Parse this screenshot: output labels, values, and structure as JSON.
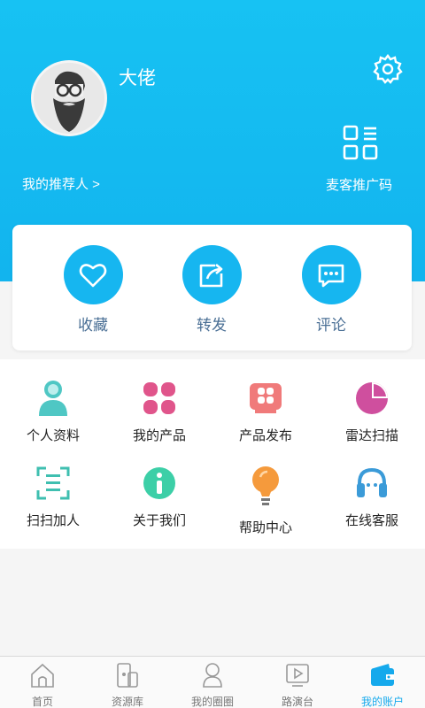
{
  "profile": {
    "username": "大佬",
    "recommender_label": "我的推荐人 >",
    "qr_label": "麦客推广码"
  },
  "actions": [
    {
      "label": "收藏",
      "icon": "heart-icon"
    },
    {
      "label": "转发",
      "icon": "share-icon"
    },
    {
      "label": "评论",
      "icon": "comment-icon"
    }
  ],
  "grid": [
    {
      "label": "个人资料",
      "icon": "person-icon",
      "color": "#4fc7c4"
    },
    {
      "label": "我的产品",
      "icon": "four-petal-icon",
      "color": "#e0558b"
    },
    {
      "label": "产品发布",
      "icon": "publish-board-icon",
      "color": "#f07a7a"
    },
    {
      "label": "雷达扫描",
      "icon": "pie-radar-icon",
      "color": "#cf4f9e"
    },
    {
      "label": "扫扫加人",
      "icon": "scan-icon",
      "color": "#3fbfb0"
    },
    {
      "label": "关于我们",
      "icon": "info-icon",
      "color": "#3ccfa7"
    },
    {
      "label": "帮助中心",
      "icon": "lightbulb-icon",
      "color": "#f59a3c"
    },
    {
      "label": "在线客服",
      "icon": "headset-icon",
      "color": "#3b9bd8"
    }
  ],
  "tabs": [
    {
      "label": "首页",
      "icon": "home-icon",
      "active": false
    },
    {
      "label": "资源库",
      "icon": "resource-icon",
      "active": false
    },
    {
      "label": "我的圈圈",
      "icon": "circle-person-icon",
      "active": false
    },
    {
      "label": "路演台",
      "icon": "play-icon",
      "active": false
    },
    {
      "label": "我的账户",
      "icon": "wallet-icon",
      "active": true
    }
  ],
  "colors": {
    "header": "#17c2f3",
    "accent": "#16b6f0",
    "active_tab": "#15a9ec"
  }
}
